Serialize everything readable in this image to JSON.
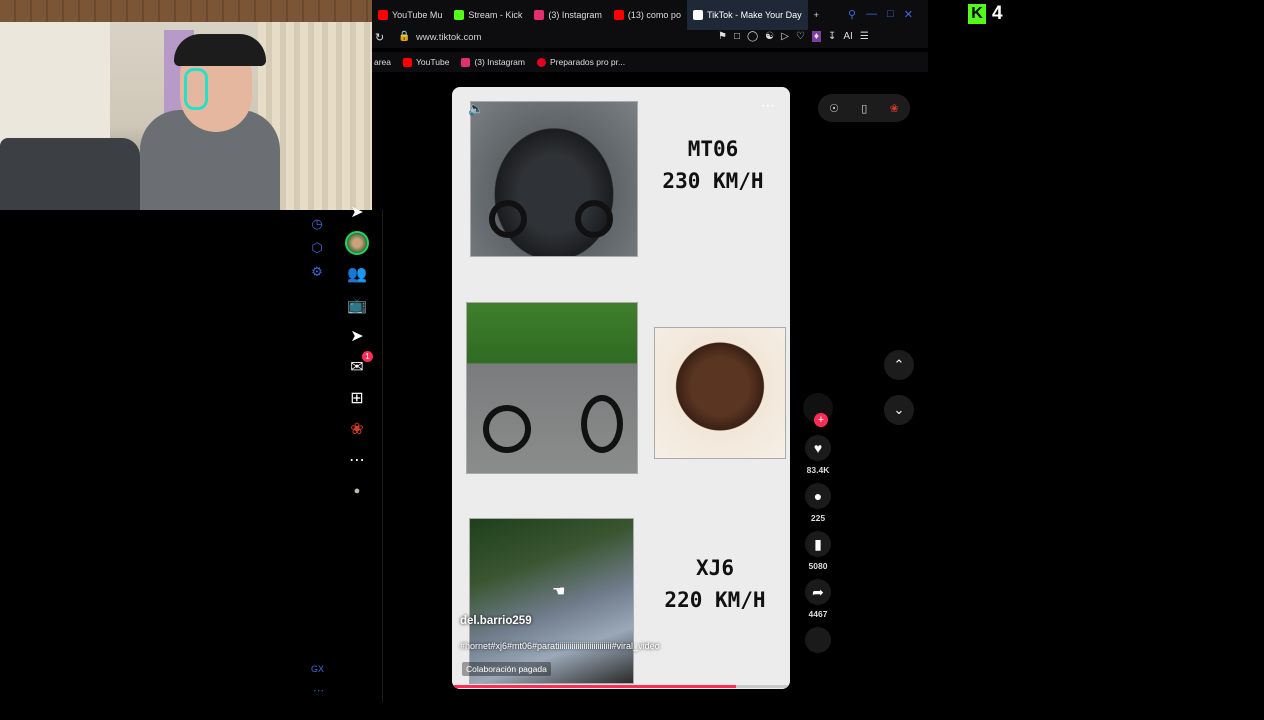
{
  "tabs": [
    {
      "label": "YouTube Mu",
      "icon": "youtube-music-icon",
      "color": "#ff0000"
    },
    {
      "label": "Stream - Kick",
      "icon": "kick-icon",
      "color": "#53fc18"
    },
    {
      "label": "(3) Instagram",
      "icon": "instagram-icon",
      "color": "#e1306c"
    },
    {
      "label": "(13) como po",
      "icon": "youtube-icon",
      "color": "#ff0000"
    },
    {
      "label": "TikTok - Make Your Day",
      "icon": "tiktok-icon",
      "color": "#ffffff",
      "active": true
    }
  ],
  "address": {
    "url": "www.tiktok.com"
  },
  "bookmarks": [
    {
      "label": "area",
      "icon": "",
      "color": ""
    },
    {
      "label": "YouTube",
      "icon": "youtube-icon",
      "color": "#ff0000"
    },
    {
      "label": "(3) Instagram",
      "icon": "instagram-icon",
      "color": "#e1306c"
    },
    {
      "label": "Preparados pro pr...",
      "icon": "pinterest-icon",
      "color": "#e60023"
    }
  ],
  "video": {
    "spec_top_model": "MT06",
    "spec_top_speed": "230 KM/H",
    "spec_bottom_model": "XJ6",
    "spec_bottom_speed": "220 KM/H",
    "username": "del.barrio259",
    "hashtags": "#hornet#xj6#mt06#paratiiiiiiiiiiiiiiiiiiiiiiiiiii#viral_video",
    "paid_label": "Colaboración pagada",
    "progress": 0.84
  },
  "actions": {
    "likes": "83.4K",
    "comments": "225",
    "saves": "5080",
    "shares": "4467"
  },
  "sidebar": {
    "gx_label": "GX",
    "messages_badge": "1"
  },
  "kick_overlay": {
    "count": "4"
  },
  "colors": {
    "accent": "#fe2c55",
    "kick": "#53fc18",
    "opera_blue": "#3a6bd8"
  }
}
